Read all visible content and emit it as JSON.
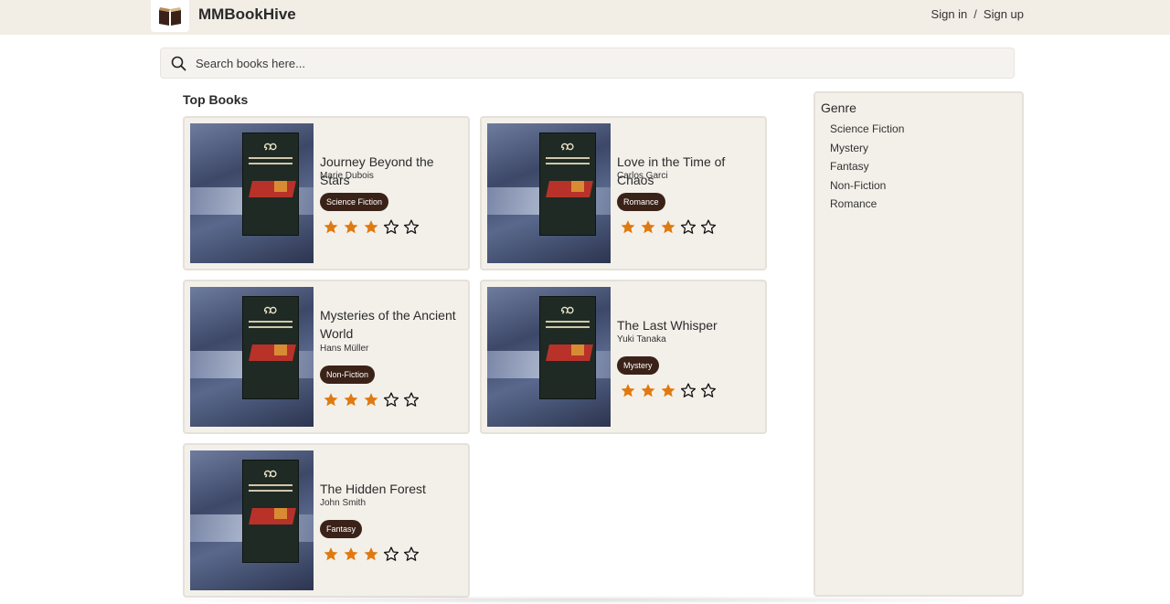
{
  "header": {
    "brand": "MMBookHive",
    "sign_in": "Sign in",
    "separator": "/",
    "sign_up": "Sign up"
  },
  "search": {
    "placeholder": "Search books here...",
    "icon": "search-icon"
  },
  "section": {
    "title": "Top Books"
  },
  "books": [
    {
      "title": "Journey Beyond the Stars",
      "author": "Marie Dubois",
      "genre": "Science Fiction",
      "rating": 3,
      "max_rating": 5
    },
    {
      "title": "Love in the Time of Chaos",
      "author": "Carlos Garci",
      "genre": "Romance",
      "rating": 3,
      "max_rating": 5
    },
    {
      "title": "Mysteries of the Ancient World",
      "author": "Hans Müller",
      "genre": "Non-Fiction",
      "rating": 3,
      "max_rating": 5
    },
    {
      "title": "The Last Whisper",
      "author": "Yuki Tanaka",
      "genre": "Mystery",
      "rating": 3,
      "max_rating": 5
    },
    {
      "title": "The Hidden Forest",
      "author": "John Smith",
      "genre": "Fantasy",
      "rating": 3,
      "max_rating": 5
    }
  ],
  "genre_panel": {
    "title": "Genre",
    "items": [
      "Science Fiction",
      "Mystery",
      "Fantasy",
      "Non-Fiction",
      "Romance"
    ]
  },
  "colors": {
    "header_bg": "#f2ede5",
    "card_bg": "#f3f0ea",
    "badge_bg": "#3b2218",
    "star_filled": "#e07a10"
  }
}
